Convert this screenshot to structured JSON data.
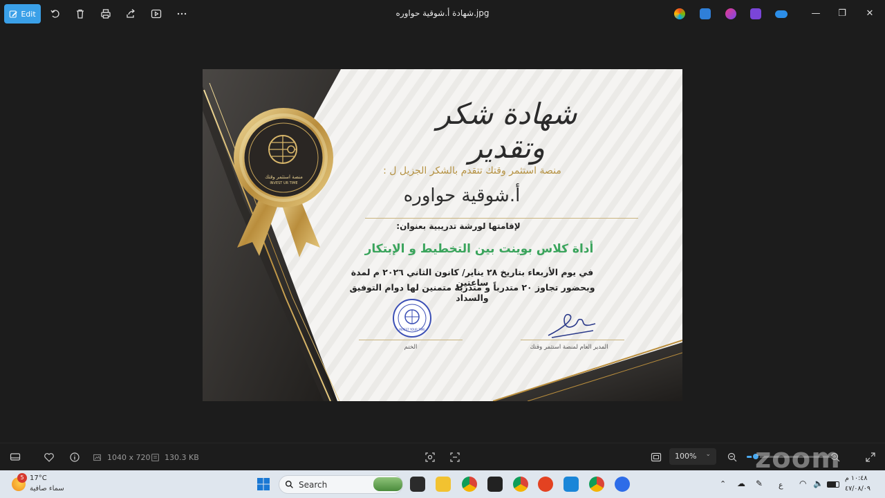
{
  "window": {
    "title": "شهادة أ.شوقية حواوره.jpg",
    "edit_label": "Edit"
  },
  "certificate": {
    "heading": "شهادة شكر وتقدير",
    "intro": "منصة استثمر وقتك تتقدم بالشكر الجزيل ل :",
    "recipient": "أ.شوقية حواوره",
    "label": "لإقامتها لورشة تدريبية بعنوان:",
    "workshop": "أداة كلاس بوينت بين التخطيط و الإبتكار",
    "detail_line1": "في يوم الأربعاء بتاريخ ٢٨ يناير/ كانون الثاني ٢٠٢٦ م  لمدة ساعتين",
    "detail_line2": "وبحضور تجاوز ٢٠ متدرباً و متدربة متمنين لها دوام التوفيق والسداد",
    "signature_label": "المدير العام لمنصة استثمر وقتك",
    "stamp_label": "الختم",
    "badge_text": "منصة استثمر وقتك",
    "badge_subtext": "INVEST UR TIME",
    "stamp_text": "INVEST YOUR TIME"
  },
  "infobar": {
    "dimensions": "1040 x 720",
    "file_size": "130.3 KB",
    "zoom": "100%",
    "zoom_percent": 10,
    "watermark": "zoom"
  },
  "taskbar": {
    "temperature": "17°C",
    "weather_desc": "سماء صافية",
    "weather_badge": "5",
    "search_label": "Search",
    "time": "١٠:٤٨ م",
    "date": "٤٧/٠٨/٠٩",
    "lang": "ع"
  },
  "colors": {
    "accent": "#3aa0e8",
    "gold": "#b59243",
    "green": "#3aa45c"
  }
}
